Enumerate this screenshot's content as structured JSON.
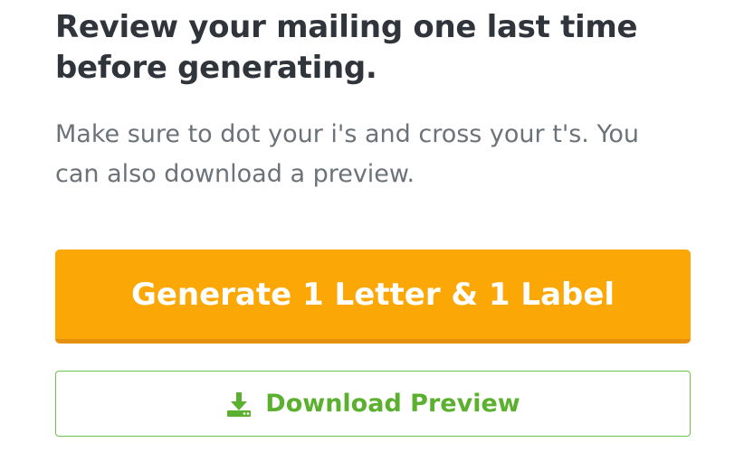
{
  "review": {
    "title": "Review your mailing one last time before generating.",
    "subtitle": "Make sure to dot your i's and cross your t's. You can also download a preview."
  },
  "actions": {
    "generate_label": "Generate 1 Letter & 1 Label",
    "download_label": "Download Preview",
    "download_icon": "download-icon"
  },
  "colors": {
    "generate_bg": "#fba705",
    "download_accent": "#5cb02f"
  }
}
